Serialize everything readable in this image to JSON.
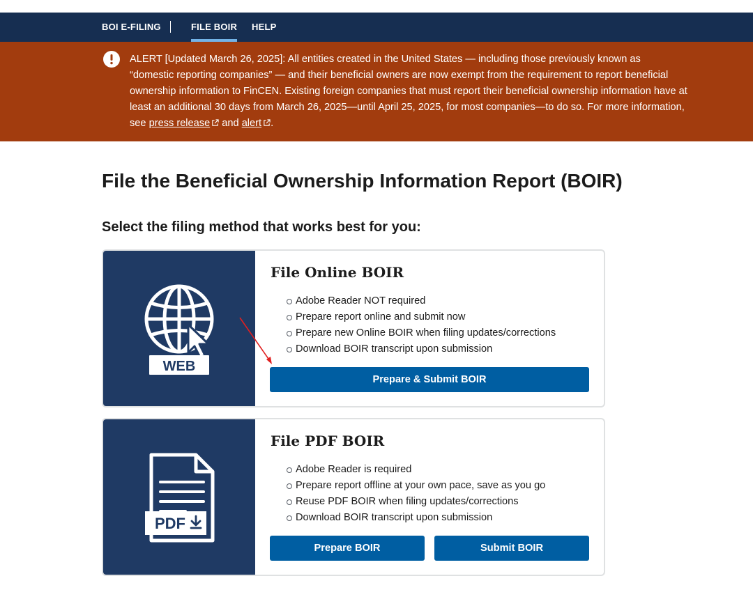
{
  "nav": {
    "items": [
      {
        "label": "BOI E-FILING"
      },
      {
        "label": "FILE BOIR"
      },
      {
        "label": "HELP"
      }
    ]
  },
  "alert": {
    "icon": "exclamation-circle-icon",
    "text": "ALERT [Updated March 26, 2025]: All entities created in the United States — including those previously known as “domestic reporting companies” — and their beneficial owners are now exempt from the requirement to report beneficial ownership information to FinCEN. Existing foreign companies that must report their beneficial ownership information have at least an additional 30 days from March 26, 2025—until April 25, 2025, for most companies—to do so. For more information, see",
    "press_release_link": "press release",
    "and_text": "and",
    "alert_link": "alert",
    "period": "."
  },
  "page": {
    "title": "File the Beneficial Ownership Information Report (BOIR)",
    "subtitle": "Select the filing method that works best for you:"
  },
  "online_card": {
    "heading": "File Online BOIR",
    "icon": "globe-cursor-icon",
    "badge": "WEB",
    "features": [
      "Adobe Reader NOT required",
      "Prepare report online and submit now",
      "Prepare new Online BOIR when filing updates/corrections",
      "Download BOIR transcript upon submission"
    ],
    "button_label": "Prepare & Submit BOIR"
  },
  "pdf_card": {
    "heading": "File PDF BOIR",
    "icon": "pdf-document-icon",
    "badge": "PDF",
    "features": [
      "Adobe Reader is required",
      "Prepare report offline at your own pace, save as you go",
      "Reuse PDF BOIR when filing updates/corrections",
      "Download BOIR transcript upon submission"
    ],
    "prepare_label": "Prepare BOIR",
    "submit_label": "Submit BOIR"
  },
  "colors": {
    "nav_bg": "#162e51",
    "alert_bg": "#a23c0e",
    "card_media_bg": "#1f3a64",
    "button_bg": "#005ea2",
    "annotation_arrow": "#e02020"
  }
}
